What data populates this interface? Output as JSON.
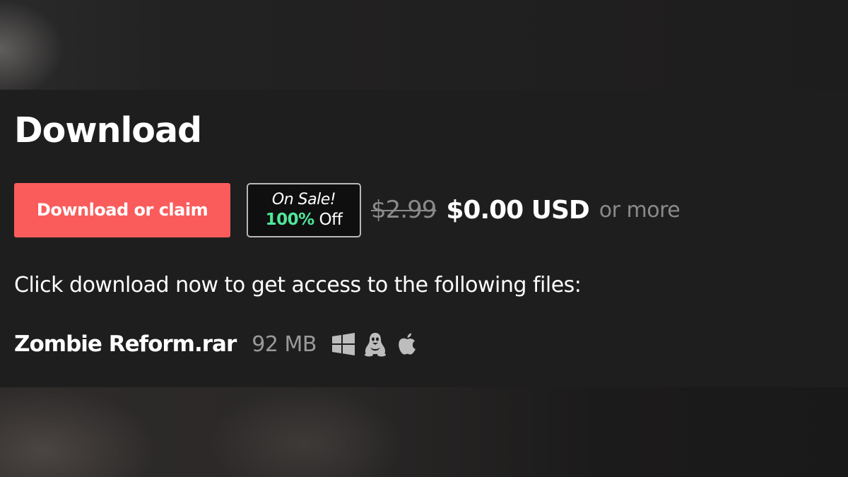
{
  "purchase_section": {
    "title": "Download",
    "download_button_label": "Download or claim",
    "sale_badge": {
      "line1": "On Sale!",
      "percent": "100%",
      "off_label": "Off"
    },
    "original_price": "$2.99",
    "current_price": "$0.00 USD",
    "or_more_label": "or more",
    "instructions": "Click download now to get access to the following files:"
  },
  "files": [
    {
      "name": "Zombie Reform.rar",
      "size": "92 MB",
      "platform_icons": [
        "windows-icon",
        "linux-icon",
        "apple-icon"
      ]
    }
  ],
  "colors": {
    "accent": "#fa5c5c",
    "sale_percent": "#4fe69a",
    "background": "#1f1e1e"
  }
}
